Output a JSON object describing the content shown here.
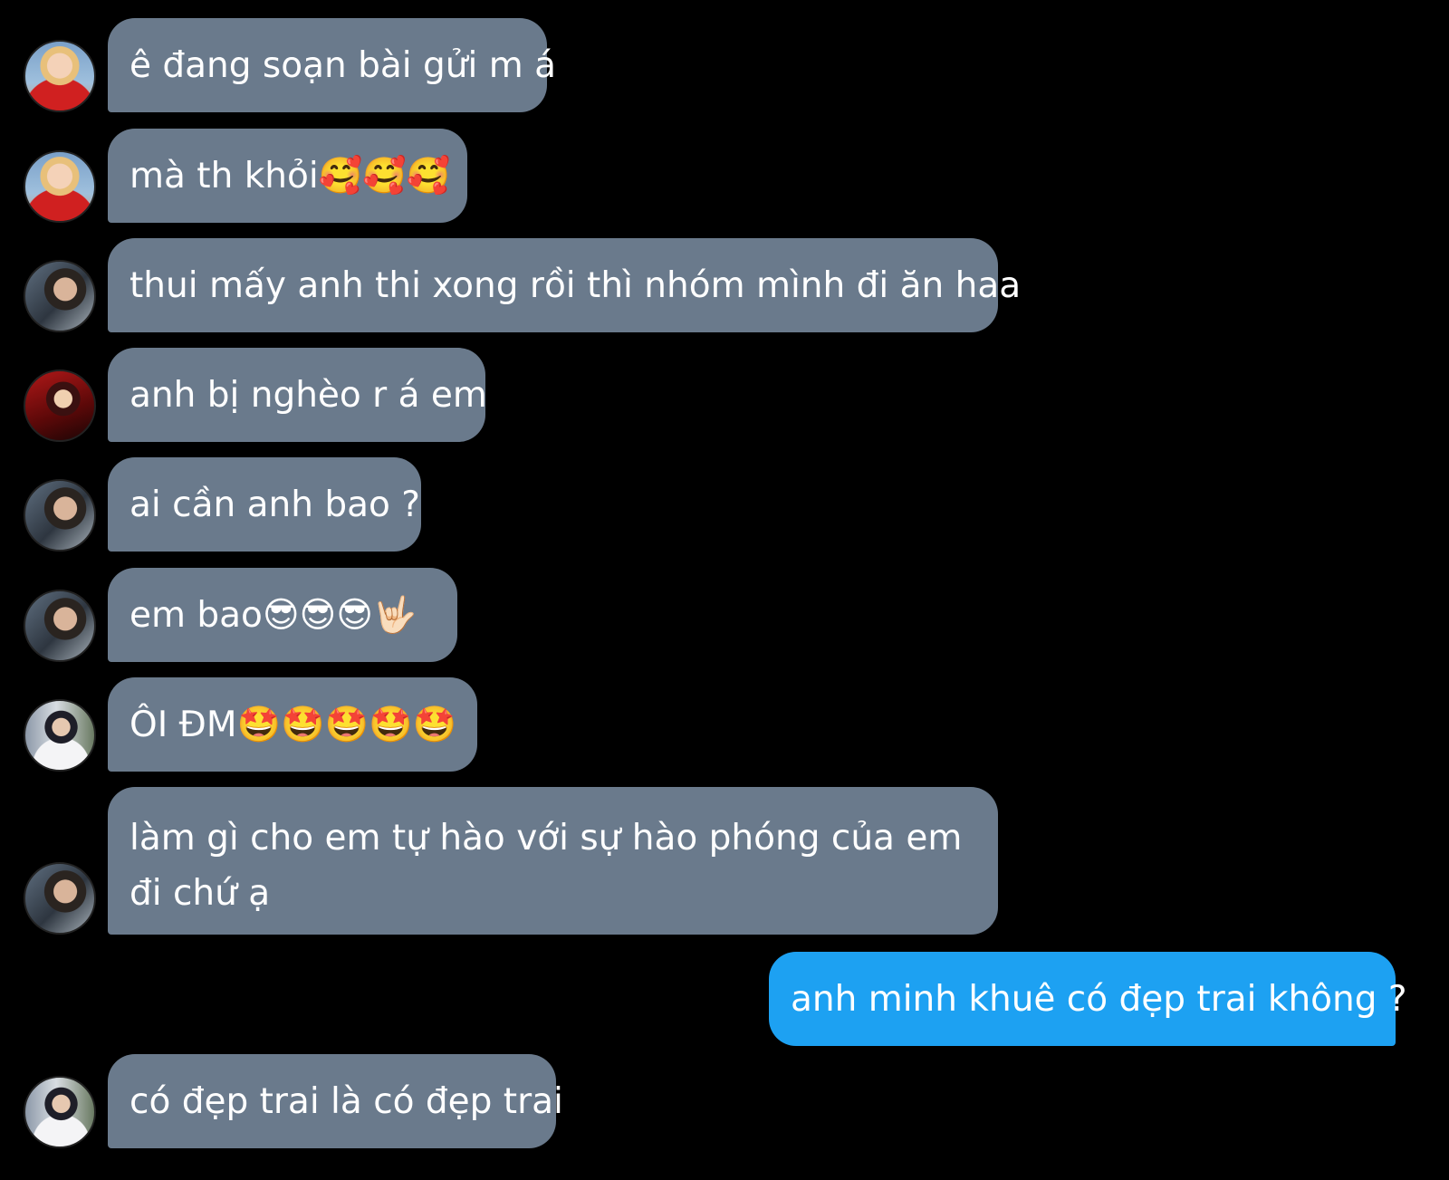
{
  "theme": {
    "background": "#000000",
    "incoming_bubble": "#6a7a8c",
    "outgoing_bubble": "#1da1f2",
    "text": "#ffffff"
  },
  "messages": [
    {
      "from": "incoming",
      "avatar": "avatar-icon",
      "text": "ê đang soạn bài gửi m á"
    },
    {
      "from": "incoming",
      "avatar": "avatar-icon",
      "text": "mà th khỏi🥰🥰🥰"
    },
    {
      "from": "incoming",
      "avatar": "avatar-icon",
      "text": "thui mấy anh thi xong rồi thì nhóm mình đi ăn haa"
    },
    {
      "from": "incoming",
      "avatar": "avatar-icon",
      "text": "anh bị nghèo r á em"
    },
    {
      "from": "incoming",
      "avatar": "avatar-icon",
      "text": "ai cần anh bao ?"
    },
    {
      "from": "incoming",
      "avatar": "avatar-icon",
      "text": "em bao😎😎😎🤟🏻"
    },
    {
      "from": "incoming",
      "avatar": "avatar-icon",
      "text": "ÔI ĐM🤩🤩🤩🤩🤩"
    },
    {
      "from": "incoming",
      "avatar": "avatar-icon",
      "text": "làm gì cho em tự hào với sự hào phóng của em đi chứ ạ"
    },
    {
      "from": "outgoing",
      "text": "anh minh khuê có đẹp trai không ?"
    },
    {
      "from": "incoming",
      "avatar": "avatar-icon",
      "text": "có đẹp trai là có đẹp trai"
    }
  ]
}
